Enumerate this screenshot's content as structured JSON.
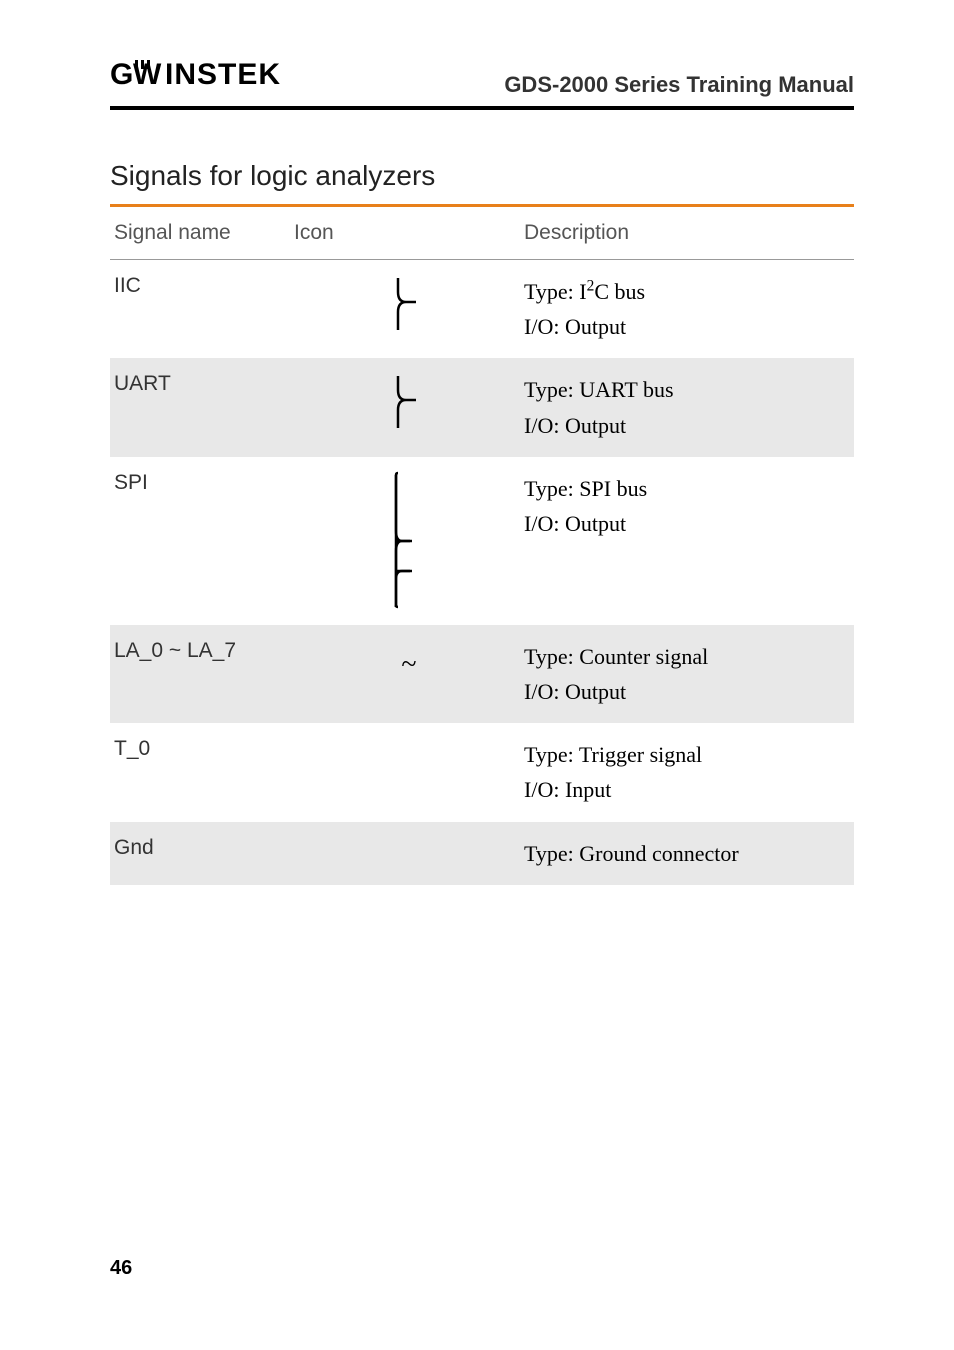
{
  "header": {
    "logo_text": "GWINSTEK",
    "doc_title": "GDS-2000 Series Training Manual"
  },
  "section": {
    "title": "Signals for logic analyzers"
  },
  "table": {
    "headers": {
      "name": "Signal name",
      "icon": "Icon",
      "desc": "Description"
    },
    "rows": [
      {
        "name": "IIC",
        "icon": "bracket-small",
        "desc_line1": "Type: I²C bus",
        "desc_line2": "I/O: Output",
        "shaded": false
      },
      {
        "name": "UART",
        "icon": "bracket-small",
        "desc_line1": "Type: UART bus",
        "desc_line2": "I/O: Output",
        "shaded": true
      },
      {
        "name": "SPI",
        "icon": "bracket-large",
        "desc_line1": "Type: SPI bus",
        "desc_line2": "I/O: Output",
        "shaded": false
      },
      {
        "name": "LA_0 ~ LA_7",
        "icon": "tilde",
        "desc_line1": "Type: Counter signal",
        "desc_line2": "I/O: Output",
        "shaded": true
      },
      {
        "name": "T_0",
        "icon": "",
        "desc_line1": "Type: Trigger signal",
        "desc_line2": "I/O: Input",
        "shaded": false
      },
      {
        "name": "Gnd",
        "icon": "",
        "desc_line1": "Type: Ground connector",
        "desc_line2": "",
        "shaded": true
      }
    ]
  },
  "page_number": "46"
}
